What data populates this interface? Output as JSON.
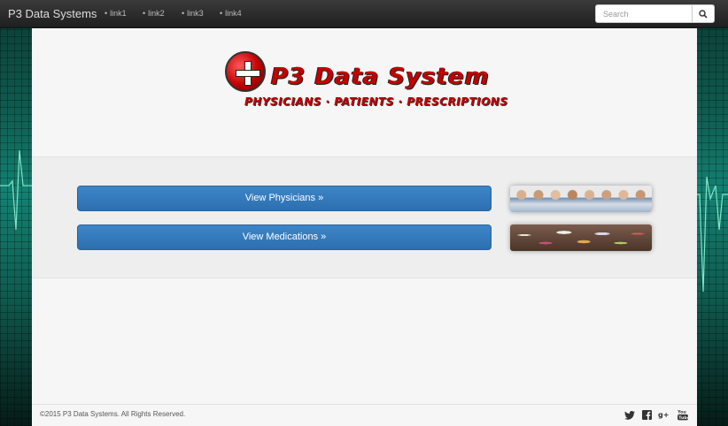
{
  "navbar": {
    "brand": "P3 Data Systems",
    "links": [
      "link1",
      "link2",
      "link3",
      "link4"
    ],
    "search": {
      "placeholder": "Search",
      "value": ""
    }
  },
  "logo": {
    "title": "P3 Data System",
    "subtitle": "PHYSICIANS · PATIENTS · PRESCRIPTIONS"
  },
  "actions": [
    {
      "label": "View Physicians »",
      "image": "physicians-group-photo"
    },
    {
      "label": "View Medications »",
      "image": "pills-photo"
    }
  ],
  "footer": {
    "copyright": "©2015 P3 Data Systems. All Rights Reserved.",
    "social": [
      "twitter-icon",
      "facebook-icon",
      "google-plus-icon",
      "youtube-icon"
    ]
  },
  "colors": {
    "primary_button": "#337ab7",
    "logo_red": "#c40000",
    "navbar": "#2a2a2a",
    "background_teal": "#138172"
  }
}
